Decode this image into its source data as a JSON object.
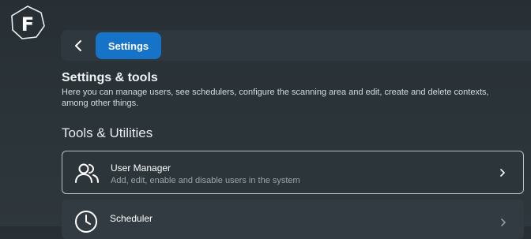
{
  "app": {
    "logo_letter": "F"
  },
  "header": {
    "back_icon": "chevron-left-icon",
    "breadcrumb_label": "Settings"
  },
  "page": {
    "title": "Settings & tools",
    "description": "Here you can manage users, see schedulers, configure the scanning area and edit, create and delete contexts, among other things."
  },
  "section": {
    "title": "Tools & Utilities",
    "items": [
      {
        "title": "User Manager",
        "subtitle": "Add, edit, enable and disable users in the system",
        "icon": "users-icon"
      },
      {
        "title": "Scheduler",
        "subtitle": "",
        "icon": "clock-icon"
      }
    ]
  },
  "colors": {
    "accent": "#1673c8",
    "background": "#2b3439"
  }
}
